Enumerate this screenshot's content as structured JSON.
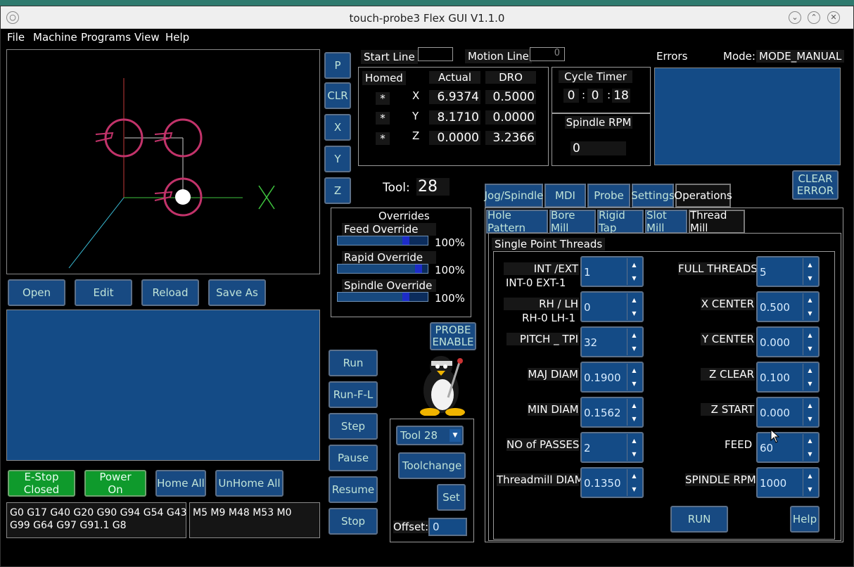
{
  "window": {
    "title": "touch-probe3 Flex GUI V1.1.0"
  },
  "menu": [
    "File",
    "Machine",
    "Programs",
    "View",
    "Help"
  ],
  "file_buttons": {
    "open": "Open",
    "edit": "Edit",
    "reload": "Reload",
    "save_as": "Save As"
  },
  "side_buttons": {
    "p": "P",
    "clr": "CLR",
    "x": "X",
    "y": "Y",
    "z": "Z"
  },
  "start_line": {
    "label": "Start Line",
    "value": ""
  },
  "motion_line": {
    "label": "Motion Line",
    "value": "0"
  },
  "dro": {
    "homed_label": "Homed",
    "actual_label": "Actual",
    "dro_label": "DRO",
    "rows": [
      {
        "homed": "*",
        "axis": "X",
        "actual": "6.9374",
        "dro": "0.5000"
      },
      {
        "homed": "*",
        "axis": "Y",
        "actual": "8.1710",
        "dro": "0.0000"
      },
      {
        "homed": "*",
        "axis": "Z",
        "actual": "0.0000",
        "dro": "3.2366"
      }
    ]
  },
  "cycle_timer": {
    "label": "Cycle Timer",
    "h": "0",
    "m": "0",
    "s": "18",
    "sep": ":"
  },
  "spindle": {
    "label": "Spindle RPM",
    "value": "0"
  },
  "errors": {
    "label": "Errors",
    "clear_label": "CLEAR\nERROR"
  },
  "mode": {
    "label": "Mode:",
    "value": "MODE_MANUAL"
  },
  "tool": {
    "label": "Tool:",
    "value": "28"
  },
  "overrides": {
    "title": "Overrides",
    "items": [
      {
        "label": "Feed Override",
        "value": "100%",
        "level": 0.78
      },
      {
        "label": "Rapid Override",
        "value": "100%",
        "level": 0.93
      },
      {
        "label": "Spindle Override",
        "value": "100%",
        "level": 0.78
      }
    ]
  },
  "probe_enable": "PROBE\nENABLE",
  "run_buttons": {
    "run": "Run",
    "run_from_line": "Run-F-L",
    "step": "Step",
    "pause": "Pause",
    "resume": "Resume",
    "stop": "Stop"
  },
  "toolchange": {
    "select": "Tool 28",
    "toolchange": "Toolchange",
    "set": "Set",
    "offset_label": "Offset:",
    "offset_value": "0"
  },
  "status_buttons": {
    "estop": "E-Stop\nClosed",
    "power": "Power\nOn",
    "home_all": "Home All",
    "unhome_all": "UnHome All"
  },
  "gcodes": {
    "g": "G0 G17 G40 G20 G90 G94 G54 G43\nG99 G64 G97 G91.1 G8",
    "m": "M5 M9 M48 M53 M0"
  },
  "tabs_main": [
    "Jog/Spindle",
    "MDI",
    "Probe",
    "Settings",
    "Operations"
  ],
  "tabs_sub": [
    "Hole Pattern",
    "Bore Mill",
    "Rigid Tap",
    "Slot Mill",
    "Thread Mill"
  ],
  "thread": {
    "group": "Single Point Threads",
    "int_ext": {
      "label": "INT /EXT",
      "sub": "INT-0  EXT-1",
      "value": "1"
    },
    "rh_lh": {
      "label": "RH / LH",
      "sub": "RH-0  LH-1",
      "value": "0"
    },
    "pitch": {
      "label": "PITCH _ TPI",
      "value": "32"
    },
    "maj_diam": {
      "label": "MAJ DIAM",
      "value": "0.1900"
    },
    "min_diam": {
      "label": "MIN DIAM",
      "value": "0.1562"
    },
    "passes": {
      "label": "NO of PASSES",
      "value": "2"
    },
    "tm_diam": {
      "label": "Threadmill DIAM",
      "value": "0.1350"
    },
    "full_threads": {
      "label": "FULL THREADS",
      "value": "5"
    },
    "x_center": {
      "label": "X CENTER",
      "value": "0.500"
    },
    "y_center": {
      "label": "Y CENTER",
      "value": "0.000"
    },
    "z_clear": {
      "label": "Z CLEAR",
      "value": "0.100"
    },
    "z_start": {
      "label": "Z START",
      "value": "0.000"
    },
    "feed": {
      "label": "FEED",
      "value": "60"
    },
    "spindle_rpm": {
      "label": "SPINDLE RPM",
      "value": "1000"
    },
    "run": "RUN",
    "help": "Help"
  }
}
